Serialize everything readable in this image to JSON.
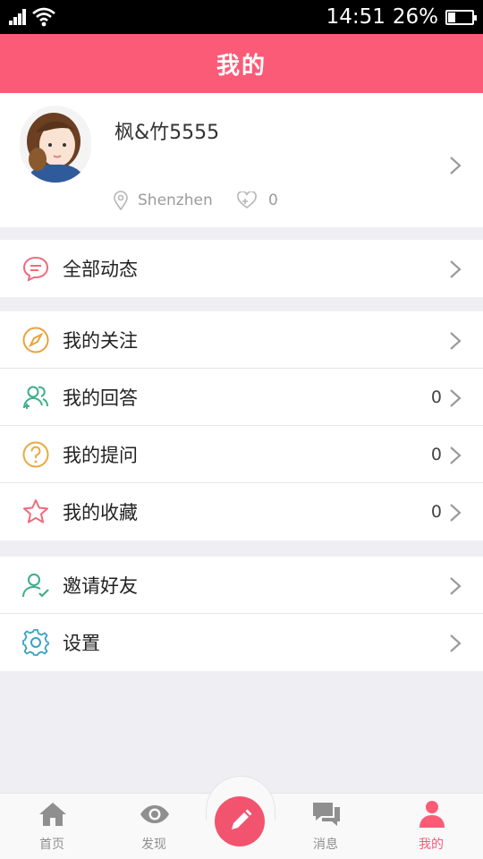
{
  "status_bar": {
    "time": "14:51",
    "battery": "26%"
  },
  "header": {
    "title": "我的"
  },
  "profile": {
    "username": "枫&竹5555",
    "location": "Shenzhen",
    "likes": "0"
  },
  "menu": {
    "group1": [
      {
        "label": "全部动态",
        "icon": "message-icon",
        "color": "#f06a7c"
      }
    ],
    "group2": [
      {
        "label": "我的关注",
        "icon": "compass-icon",
        "color": "#e8a33c"
      },
      {
        "label": "我的回答",
        "icon": "users-icon",
        "color": "#3fae8a",
        "count": "0"
      },
      {
        "label": "我的提问",
        "icon": "question-icon",
        "color": "#e9a93e",
        "count": "0"
      },
      {
        "label": "我的收藏",
        "icon": "star-icon",
        "color": "#f06a7c",
        "count": "0"
      }
    ],
    "group3": [
      {
        "label": "邀请好友",
        "icon": "invite-user-icon",
        "color": "#3fae8a"
      },
      {
        "label": "设置",
        "icon": "gear-icon",
        "color": "#37a3c3"
      }
    ]
  },
  "tabbar": {
    "tabs": [
      {
        "label": "首页",
        "icon": "home-icon"
      },
      {
        "label": "发现",
        "icon": "eye-icon"
      },
      {
        "label": "消息",
        "icon": "chat-icon"
      },
      {
        "label": "我的",
        "icon": "person-icon",
        "active": true
      }
    ],
    "compose_icon": "pencil-icon"
  },
  "colors": {
    "brand": "#fc5b77",
    "inactive": "#8f8f8f"
  }
}
